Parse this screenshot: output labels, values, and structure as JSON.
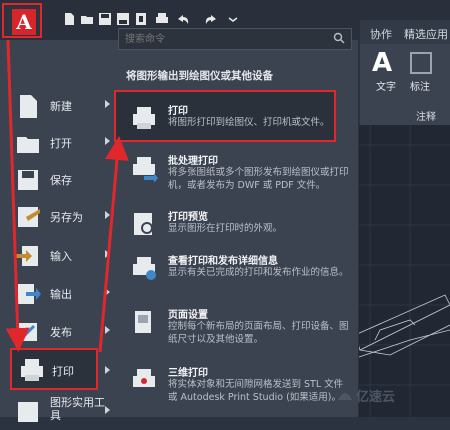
{
  "app": {
    "logo_letter": "A"
  },
  "quick_access": {
    "icons": [
      "new-icon",
      "open-icon",
      "save-icon",
      "saveas-icon",
      "web-icon",
      "print-icon",
      "undo-icon",
      "redo-icon",
      "share-icon"
    ]
  },
  "ribbon": {
    "tabs": [
      "协作",
      "精选应用"
    ],
    "text_label": "文字",
    "annotate_label": "标注",
    "panel_label": "注释"
  },
  "search": {
    "placeholder": "搜索命令"
  },
  "left_menu": [
    {
      "label": "新建",
      "icon": "new-icon",
      "has_arrow": true
    },
    {
      "label": "打开",
      "icon": "open-icon",
      "has_arrow": true
    },
    {
      "label": "保存",
      "icon": "save-icon",
      "has_arrow": false
    },
    {
      "label": "另存为",
      "icon": "saveas-icon",
      "has_arrow": true
    },
    {
      "label": "输入",
      "icon": "import-icon",
      "has_arrow": true
    },
    {
      "label": "输出",
      "icon": "export-icon",
      "has_arrow": true
    },
    {
      "label": "发布",
      "icon": "publish-icon",
      "has_arrow": true
    },
    {
      "label": "打印",
      "icon": "print-icon",
      "has_arrow": true,
      "selected": true
    },
    {
      "label": "图形实用工具",
      "icon": "utilities-icon",
      "has_arrow": true
    }
  ],
  "right_panel": {
    "header": "将图形输出到绘图仪或其他设备",
    "items": [
      {
        "title": "打印",
        "desc": "将图形打印到绘图仪、打印机或文件。",
        "icon": "print-icon"
      },
      {
        "title": "批处理打印",
        "desc": "将多张图纸或多个图形发布到绘图仪或打印机，或者发布为 DWF 或 PDF 文件。",
        "icon": "batch-print-icon"
      },
      {
        "title": "打印预览",
        "desc": "显示图形在打印时的外观。",
        "icon": "print-preview-icon"
      },
      {
        "title": "查看打印和发布详细信息",
        "desc": "显示有关已完成的打印和发布作业的信息。",
        "icon": "print-details-icon"
      },
      {
        "title": "页面设置",
        "desc": "控制每个新布局的页面布局、打印设备、图纸尺寸以及其他设置。",
        "icon": "page-setup-icon"
      },
      {
        "title": "三维打印",
        "desc": "将实体对象和无间隙网格发送到 STL 文件或 Autodesk Print Studio (如果适用)。",
        "icon": "3d-print-icon"
      }
    ]
  },
  "watermark": {
    "text": "亿速云"
  },
  "colors": {
    "accent_red": "#e0282c",
    "logo_red": "#d7262b",
    "bg": "#3c4350"
  }
}
